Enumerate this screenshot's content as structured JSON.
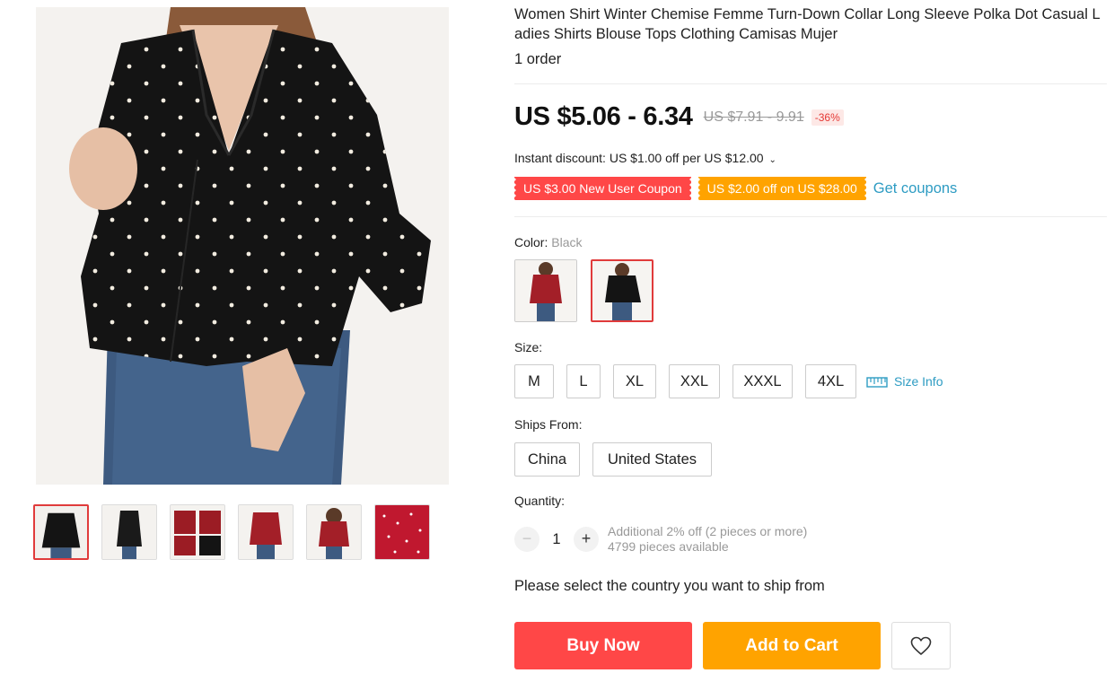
{
  "product": {
    "title": "Women Shirt Winter Chemise Femme Turn-Down Collar Long Sleeve Polka Dot Casual Ladies Shirts Blouse Tops Clothing Camisas Mujer",
    "orders": "1 order"
  },
  "gallery": {
    "main_image": "black polka dot shirt model photo",
    "thumbnails": [
      {
        "label": "black shirt front",
        "active": true
      },
      {
        "label": "black shirt side",
        "active": false
      },
      {
        "label": "red and black shirt collage",
        "active": false
      },
      {
        "label": "red shirt front",
        "active": false
      },
      {
        "label": "red shirt back",
        "active": false
      },
      {
        "label": "red fabric close-up",
        "active": false
      }
    ]
  },
  "price": {
    "current": "US $5.06 - 6.34",
    "original": "US $7.91 - 9.91",
    "discount": "-36%"
  },
  "instant_discount": {
    "text": "Instant discount: US $1.00 off per US $12.00",
    "chevron": "chevron-down-icon"
  },
  "coupons": {
    "items": [
      {
        "label": "US $3.00 New User Coupon",
        "color": "#ff4747"
      },
      {
        "label": "US $2.00 off on US $28.00",
        "color": "#ffa300"
      }
    ],
    "get_coupons": "Get coupons"
  },
  "color": {
    "label": "Color:",
    "selected": "Black",
    "options": [
      {
        "name": "Red",
        "selected": false
      },
      {
        "name": "Black",
        "selected": true
      }
    ]
  },
  "size": {
    "label": "Size:",
    "options": [
      "M",
      "L",
      "XL",
      "XXL",
      "XXXL",
      "4XL"
    ],
    "info": "Size Info",
    "info_icon": "ruler-icon"
  },
  "ships_from": {
    "label": "Ships From:",
    "options": [
      "China",
      "United States"
    ]
  },
  "quantity": {
    "label": "Quantity:",
    "value": "1",
    "minus": "−",
    "plus": "+",
    "note": "Additional 2% off (2 pieces or more)",
    "available": "4799 pieces available"
  },
  "ship_notice": "Please select the country you want to ship from",
  "actions": {
    "buy_now": "Buy Now",
    "add_to_cart": "Add to Cart",
    "wishlist_icon": "heart-icon"
  },
  "colors": {
    "accent_red": "#ff4747",
    "accent_orange": "#ffa300",
    "link_blue": "#2e9cc3"
  }
}
